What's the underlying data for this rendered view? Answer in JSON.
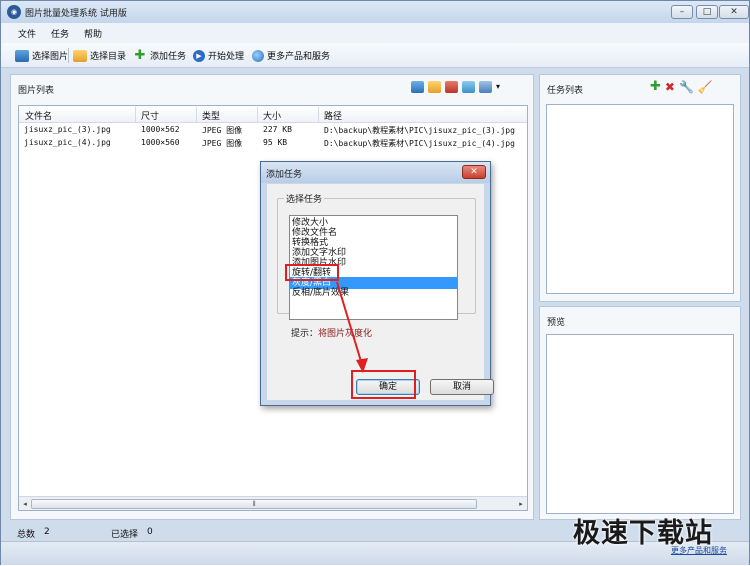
{
  "window": {
    "title": "图片批量处理系统 试用版",
    "controls": [
      "–",
      "□",
      "✕"
    ]
  },
  "menu": [
    "文件",
    "任务",
    "帮助"
  ],
  "toolbar": {
    "items": [
      {
        "label": "选择图片",
        "icon": "image-icon"
      },
      {
        "label": "选择目录",
        "icon": "folder-icon"
      },
      {
        "label": "添加任务",
        "icon": "plus-icon"
      },
      {
        "label": "开始处理",
        "icon": "play-icon"
      },
      {
        "label": "更多产品和服务",
        "icon": "globe-icon"
      }
    ]
  },
  "image_list": {
    "heading": "图片列表",
    "columns": [
      "文件名",
      "尺寸",
      "类型",
      "大小",
      "路径"
    ],
    "rows": [
      [
        "jisuxz_pic_(3).jpg",
        "1000×562",
        "JPEG 图像",
        "227 KB",
        "D:\\backup\\教程素材\\PIC\\jisuxz_pic_(3).jpg"
      ],
      [
        "jisuxz_pic_(4).jpg",
        "1000×560",
        "JPEG 图像",
        "95 KB",
        "D:\\backup\\教程素材\\PIC\\jisuxz_pic_(4).jpg"
      ]
    ]
  },
  "status": {
    "total_label": "总数",
    "total_value": "2",
    "selected_label": "已选择",
    "selected_value": "0"
  },
  "task_panel": {
    "heading": "任务列表"
  },
  "preview_panel": {
    "heading": "预览"
  },
  "dialog": {
    "title": "添加任务",
    "close": "✕",
    "group_label": "选择任务",
    "tasks": [
      "修改大小",
      "修改文件名",
      "转换格式",
      "添加文字水印",
      "添加图片水印",
      "旋转/翻转",
      "灰度/黑白",
      "反相/底片效果"
    ],
    "selected_index": 6,
    "hint_label": "提示：",
    "hint_value": "将图片灰度化",
    "ok": "确定",
    "cancel": "取消"
  },
  "watermark": {
    "text": "极速下载站",
    "link": "更多产品和服务"
  },
  "colors": {
    "selection": "#3399ff",
    "annotation": "#e02020",
    "chrome": "#cfdcec"
  }
}
